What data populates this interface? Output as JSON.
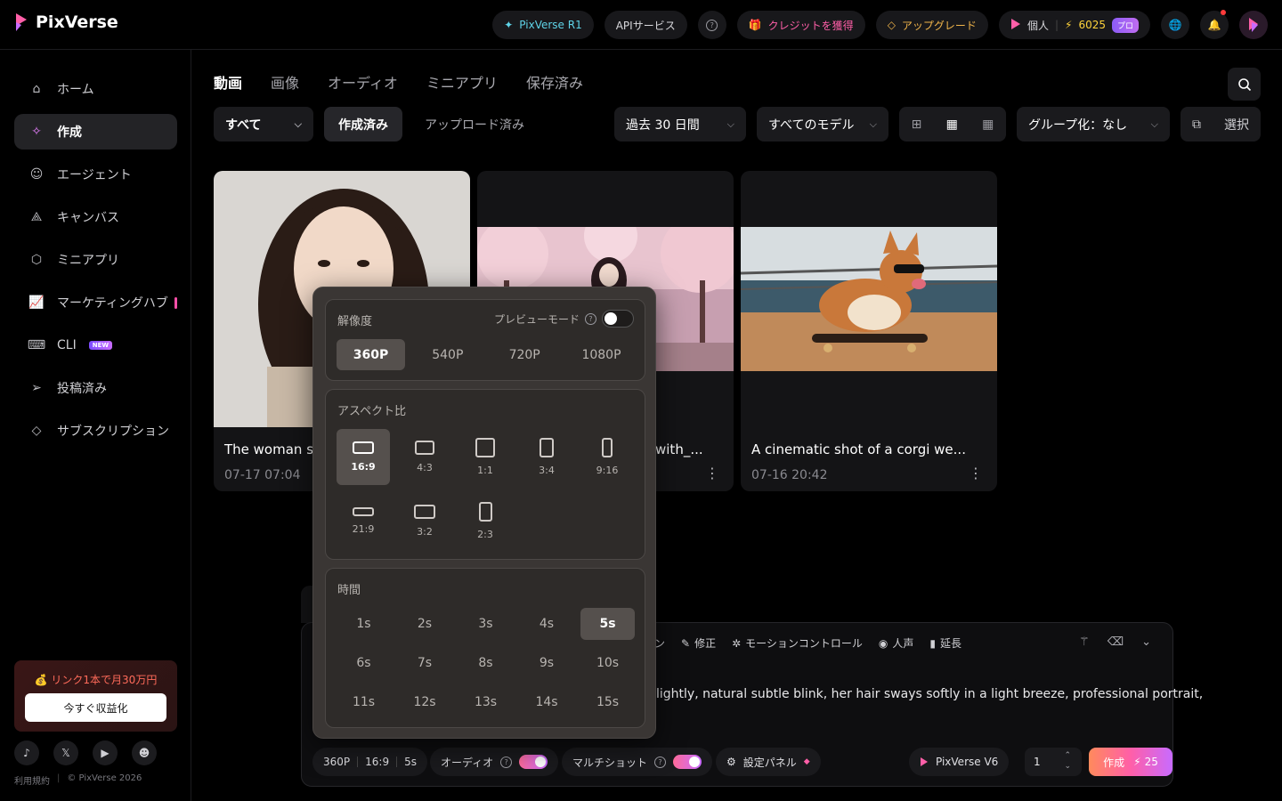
{
  "app": {
    "name": "PixVerse",
    "colors": {
      "accent_pink": "#ff5fa8",
      "accent_purple": "#c86bff",
      "background": "#000000"
    }
  },
  "topbar": {
    "r1_label": "PixVerse R1",
    "api_label": "APIサービス",
    "credits_label": "クレジットを獲得",
    "upgrade_label": "アップグレード",
    "account_label": "個人",
    "credit_count": "6025",
    "pro_badge": "プロ"
  },
  "sidebar": {
    "items": [
      {
        "label": "ホーム",
        "icon": "home-icon"
      },
      {
        "label": "作成",
        "icon": "sparkle-icon"
      },
      {
        "label": "エージェント",
        "icon": "robot-icon"
      },
      {
        "label": "キャンバス",
        "icon": "canvas-icon"
      },
      {
        "label": "ミニアプリ",
        "icon": "cube-icon"
      },
      {
        "label": "マーケティングハブ",
        "icon": "chart-icon"
      },
      {
        "label": "CLI",
        "icon": "terminal-icon",
        "badge": "NEW"
      },
      {
        "label": "投稿済み",
        "icon": "send-icon"
      },
      {
        "label": "サブスクリプション",
        "icon": "diamond-icon"
      }
    ],
    "promo_text": "💰 リンク1本で月30万円",
    "promo_button": "今すぐ収益化",
    "footer_terms": "利用規約",
    "footer_copyright": "© PixVerse 2026"
  },
  "main": {
    "tabs": [
      "動画",
      "画像",
      "オーディオ",
      "ミニアプリ",
      "保存済み"
    ],
    "filters": {
      "all": "すべて",
      "created": "作成済み",
      "uploaded": "アップロード済み",
      "period": "過去 30 日間",
      "models": "すべてのモデル",
      "group": "グループ化：なし",
      "select": "選択"
    },
    "cards": [
      {
        "title": "The woman sm",
        "date": "07-17  07:04"
      },
      {
        "title": "with_...",
        "date": ""
      },
      {
        "title": "A cinematic shot of a corgi we...",
        "date": "07-16  20:42"
      }
    ]
  },
  "prompt": {
    "tools": [
      "ン",
      "修正",
      "モーションコントロール",
      "人声",
      "延長"
    ],
    "text": "lightly, natural subtle blink, her hair sways softly in a light breeze, professional portrait,",
    "summary_res": "360P",
    "summary_ratio": "16:9",
    "summary_dur": "5s",
    "audio_label": "オーディオ",
    "multishot_label": "マルチショット",
    "settings_label": "設定パネル",
    "model_label": "PixVerse V6",
    "quantity": "1",
    "create_label": "作成",
    "create_cost": "25"
  },
  "settings": {
    "resolution_label": "解像度",
    "preview_label": "プレビューモード",
    "resolutions": [
      "360P",
      "540P",
      "720P",
      "1080P"
    ],
    "selected_resolution": "360P",
    "aspect_label": "アスペクト比",
    "aspects": [
      "16:9",
      "4:3",
      "1:1",
      "3:4",
      "9:16",
      "21:9",
      "3:2",
      "2:3"
    ],
    "selected_aspect": "16:9",
    "duration_label": "時間",
    "durations": [
      "1s",
      "2s",
      "3s",
      "4s",
      "5s",
      "6s",
      "7s",
      "8s",
      "9s",
      "10s",
      "11s",
      "12s",
      "13s",
      "14s",
      "15s"
    ],
    "selected_duration": "5s"
  }
}
